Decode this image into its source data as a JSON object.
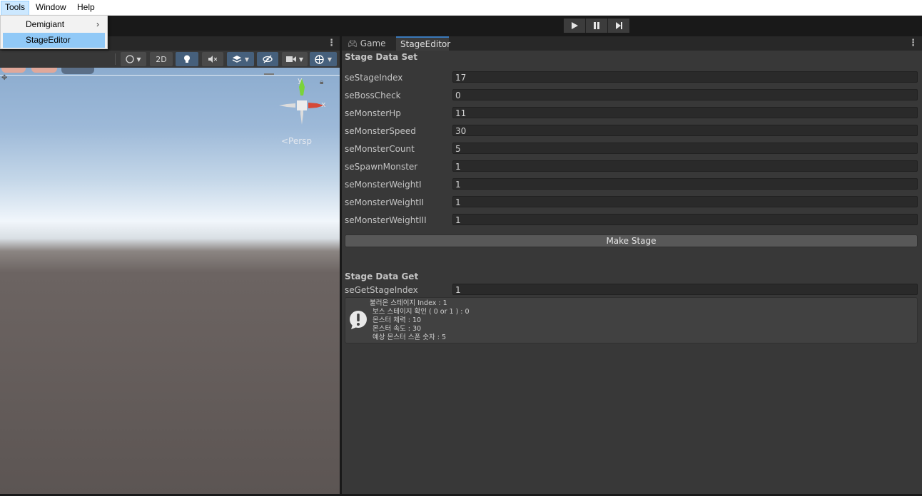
{
  "menubar": {
    "items": [
      "Tools",
      "Window",
      "Help"
    ]
  },
  "dropdown": {
    "items": [
      {
        "label": "Demigiant",
        "has_submenu": true
      },
      {
        "label": "StageEditor",
        "highlighted": true
      }
    ]
  },
  "playbar": {
    "buttons": [
      "play-icon",
      "pause-icon",
      "step-icon"
    ]
  },
  "scene": {
    "tools": {
      "two_d_label": "2D"
    },
    "persp_label": "<Persp",
    "gizmo_axes": {
      "x": "x",
      "y": "y"
    }
  },
  "right_panel": {
    "tabs": [
      {
        "label": "Game",
        "icon": "gamepad-icon"
      },
      {
        "label": "StageEditor",
        "selected": true
      }
    ],
    "set_title": "Stage Data Set",
    "fields": [
      {
        "label": "seStageIndex",
        "value": "17"
      },
      {
        "label": "seBossCheck",
        "value": "0"
      },
      {
        "label": "seMonsterHp",
        "value": "11"
      },
      {
        "label": "seMonsterSpeed",
        "value": "30"
      },
      {
        "label": "seMonsterCount",
        "value": "5"
      },
      {
        "label": "seSpawnMonster",
        "value": "1"
      },
      {
        "label": "seMonsterWeightI",
        "value": "1"
      },
      {
        "label": "seMonsterWeightII",
        "value": "1"
      },
      {
        "label": "seMonsterWeightIII",
        "value": "1"
      }
    ],
    "make_button": "Make Stage",
    "get_title": "Stage Data Get",
    "get_field": {
      "label": "seGetStageIndex",
      "value": "1"
    },
    "help_lines": [
      "불러온 스테이지 Index : 1",
      "보스 스테이지 확인 ( 0 or 1 ) : 0",
      "몬스터 체력 : 10",
      "몬스터 속도 : 30",
      "예상 몬스터 스폰 숫자 : 5"
    ]
  },
  "colors": {
    "accent": "#3a79bb",
    "highlight": "#91c9f7",
    "panel": "#383838"
  }
}
